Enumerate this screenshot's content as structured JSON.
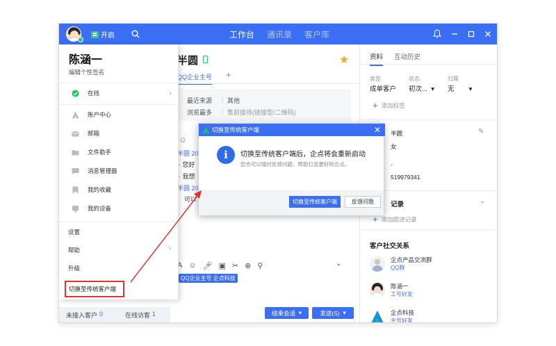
{
  "titlebar": {
    "open_label": "开启",
    "nav": [
      "工作台",
      "通讯录",
      "客户库"
    ],
    "active_nav": 0
  },
  "chat": {
    "contact_name": "半圆",
    "account_tab": "QQ企业主号",
    "source_label": "最近来源",
    "source_value": "其他",
    "browse_label": "浏览最多",
    "browse_value": "售前接待(链接型/二维码)",
    "msg1": "半圆 201",
    "msg2": "· 您好",
    "msg3": "· 我想",
    "msg4": "半圆 201",
    "msg5": "可以",
    "tag_chip": "QQ企业主号 企点科技",
    "end_button": "结束会话",
    "send_button": "发送(S)"
  },
  "right": {
    "tab_info": "资料",
    "tab_history": "互动历史",
    "type_label": "类型",
    "type_value": "成单客户",
    "status_label": "状态",
    "status_value": "初次...",
    "owner_label": "归属",
    "owner_value": "无",
    "add_tag": "添加标签",
    "name_value": "半圆",
    "gender_value": "女",
    "dash": "-",
    "qq_number": "519979341",
    "record_title": "记录",
    "add_record": "添加跟进记录",
    "social_title": "客户社交关系",
    "social": [
      {
        "name": "企点产品交流群",
        "sub": "QQ群"
      },
      {
        "name": "陈涵一",
        "sub": "工号好友"
      },
      {
        "name": "企点科技",
        "sub": "主号好友"
      }
    ]
  },
  "menu": {
    "name": "陈涵一",
    "signature": "编辑个性签名",
    "status": "在线",
    "items": [
      "账户中心",
      "邮箱",
      "文件助手",
      "消息管理器",
      "我的收藏",
      "我的设备"
    ],
    "settings": "设置",
    "help": "帮助",
    "upgrade": "升级",
    "switch": "切换至传统客户端"
  },
  "statusbar": {
    "unassigned_label": "未接入客户",
    "unassigned_count": "0",
    "online_label": "在线访客",
    "online_count": "1"
  },
  "dialog": {
    "title": "切换至传统客户端",
    "main_text": "切换至传统客户端后，企点将会重新启动",
    "sub_text": "您也可以随时反馈问题，帮助打造更好的企点。",
    "primary_button": "切换至传统客户端",
    "secondary_button": "反馈问题"
  },
  "colors": {
    "brand_blue": "#3a6ef5",
    "highlight_red": "#e0322e",
    "online_green": "#1ec96b"
  }
}
